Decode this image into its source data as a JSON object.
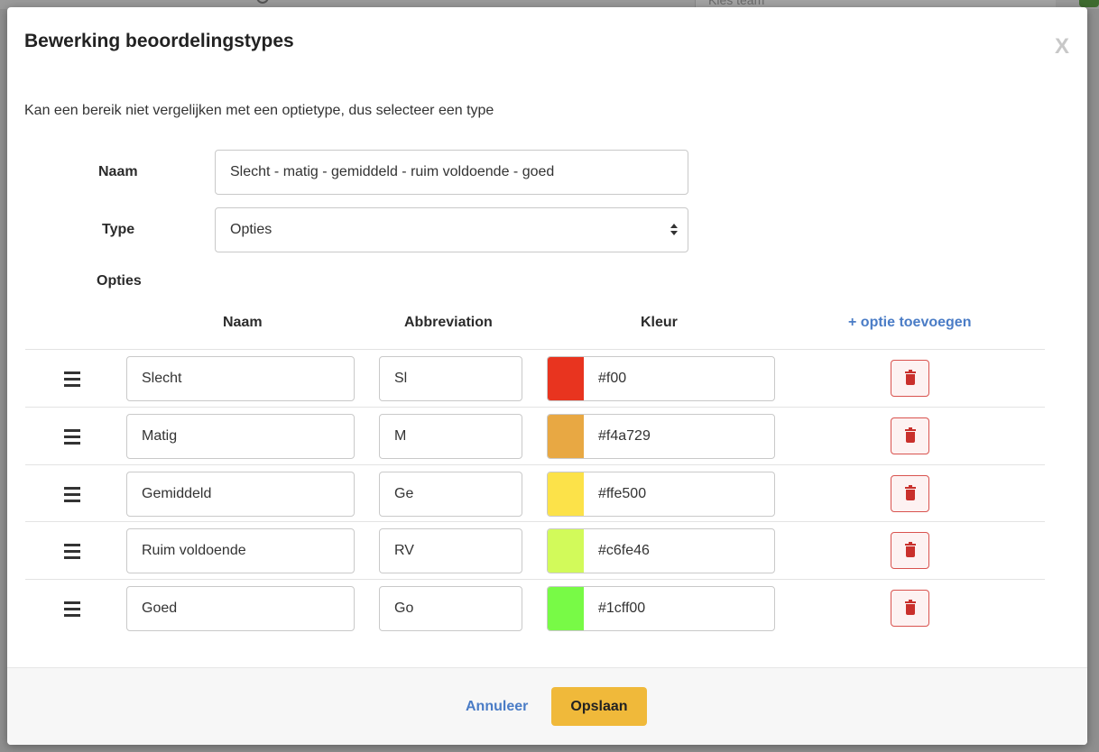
{
  "backdrop": {
    "team_placeholder": "Kies team"
  },
  "modal": {
    "title": "Bewerking beoordelingstypes",
    "close_label": "X",
    "intro": "Kan een bereik niet vergelijken met een optietype, dus selecteer een type"
  },
  "form": {
    "name_label": "Naam",
    "name_value": "Slecht - matig - gemiddeld - ruim voldoende - goed",
    "type_label": "Type",
    "type_value": "Opties",
    "options_label": "Opties"
  },
  "options_table": {
    "headers": {
      "name": "Naam",
      "abbreviation": "Abbreviation",
      "color": "Kleur"
    },
    "add_option_label": "+ optie toevoegen",
    "rows": [
      {
        "name": "Slecht",
        "abbreviation": "Sl",
        "color": "#f00",
        "swatch": "#e8341f"
      },
      {
        "name": "Matig",
        "abbreviation": "M",
        "color": "#f4a729",
        "swatch": "#e8a843"
      },
      {
        "name": "Gemiddeld",
        "abbreviation": "Ge",
        "color": "#ffe500",
        "swatch": "#fce249"
      },
      {
        "name": "Ruim voldoende",
        "abbreviation": "RV",
        "color": "#c6fe46",
        "swatch": "#d2fa5a"
      },
      {
        "name": "Goed",
        "abbreviation": "Go",
        "color": "#1cff00",
        "swatch": "#78fa46"
      }
    ]
  },
  "footer": {
    "cancel_label": "Annuleer",
    "save_label": "Opslaan"
  }
}
